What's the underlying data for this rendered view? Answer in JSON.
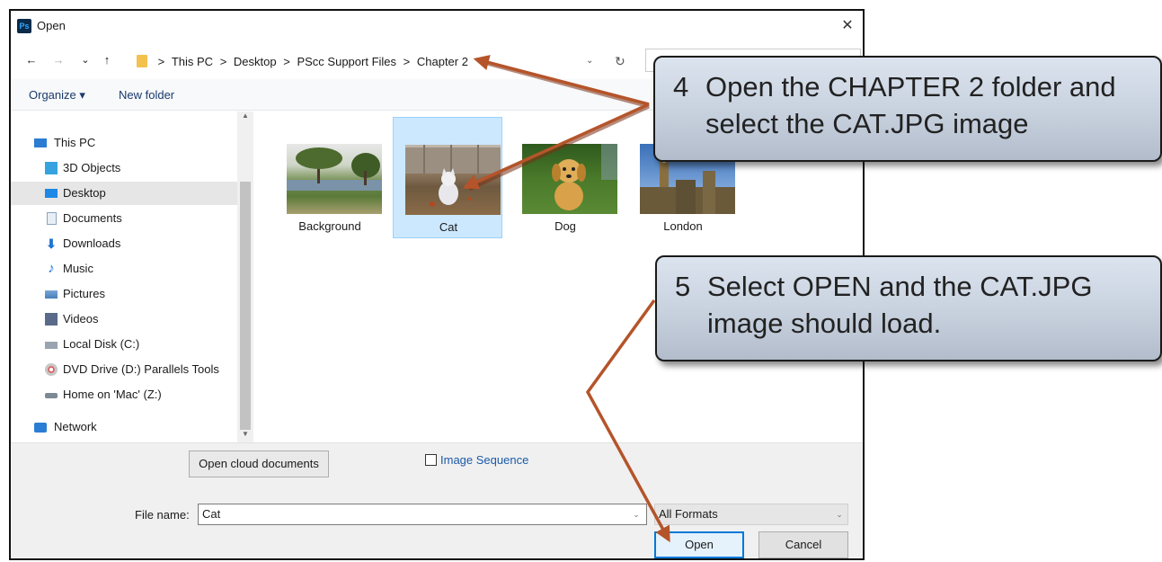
{
  "window": {
    "title": "Open",
    "app_icon": "Ps"
  },
  "nav": {
    "back": "←",
    "forward": "→",
    "recent": "⌄",
    "up": "↑",
    "breadcrumbs": [
      "This PC",
      "Desktop",
      "PScc Support Files",
      "Chapter 2"
    ],
    "separator": ">"
  },
  "toolbar": {
    "organize": "Organize ▾",
    "new_folder": "New folder"
  },
  "sidebar": {
    "items": [
      {
        "label": "This PC",
        "icon": "computer-icon",
        "indent": 0
      },
      {
        "label": "3D Objects",
        "icon": "cube-icon",
        "indent": 1
      },
      {
        "label": "Desktop",
        "icon": "desktop-icon",
        "indent": 1,
        "selected": true
      },
      {
        "label": "Documents",
        "icon": "document-icon",
        "indent": 1
      },
      {
        "label": "Downloads",
        "icon": "download-icon",
        "indent": 1
      },
      {
        "label": "Music",
        "icon": "music-icon",
        "indent": 1
      },
      {
        "label": "Pictures",
        "icon": "pictures-icon",
        "indent": 1
      },
      {
        "label": "Videos",
        "icon": "video-icon",
        "indent": 1
      },
      {
        "label": "Local Disk (C:)",
        "icon": "drive-icon",
        "indent": 1
      },
      {
        "label": "DVD Drive (D:) Parallels Tools",
        "icon": "dvd-icon",
        "indent": 1
      },
      {
        "label": "Home on 'Mac' (Z:)",
        "icon": "network-drive-icon",
        "indent": 1
      },
      {
        "label": "Network",
        "icon": "network-icon",
        "indent": 0
      }
    ]
  },
  "files": [
    {
      "name": "Background",
      "selected": false
    },
    {
      "name": "Cat",
      "selected": true
    },
    {
      "name": "Dog",
      "selected": false
    },
    {
      "name": "London",
      "selected": false
    }
  ],
  "bottom": {
    "cloud_button": "Open cloud documents",
    "image_sequence": "Image Sequence",
    "file_name_label": "File name:",
    "file_name_value": "Cat",
    "format": "All Formats",
    "open_button": "Open",
    "cancel_button": "Cancel"
  },
  "callouts": [
    {
      "number": "4",
      "text": "Open the CHAPTER 2 folder and select the CAT.JPG image"
    },
    {
      "number": "5",
      "text": "Select OPEN and the CAT.JPG image should load."
    }
  ],
  "colors": {
    "arrow": "#b5542a",
    "selection": "#cce8ff",
    "accent": "#0078d7"
  }
}
